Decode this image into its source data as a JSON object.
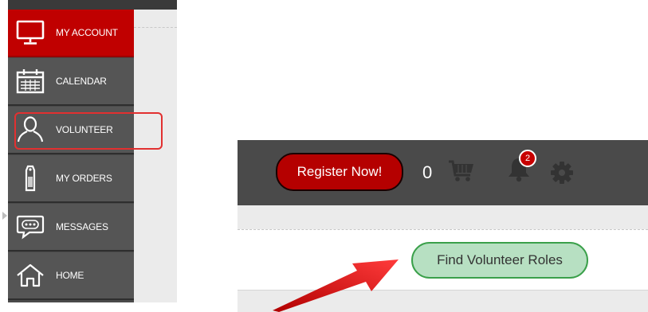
{
  "sidebar": {
    "items": [
      {
        "label": "MY ACCOUNT",
        "icon": "monitor-icon",
        "active": true
      },
      {
        "label": "CALENDAR",
        "icon": "calendar-icon",
        "active": false
      },
      {
        "label": "VOLUNTEER",
        "icon": "person-icon",
        "active": false
      },
      {
        "label": "MY ORDERS",
        "icon": "tag-icon",
        "active": false
      },
      {
        "label": "MESSAGES",
        "icon": "chat-icon",
        "active": false
      },
      {
        "label": "HOME",
        "icon": "home-icon",
        "active": false
      }
    ]
  },
  "header": {
    "register_label": "Register Now!",
    "cart_count": "0",
    "notification_count": "2"
  },
  "content": {
    "find_roles_label": "Find Volunteer Roles"
  },
  "colors": {
    "sidebar_bg": "#555555",
    "active_red": "#c00000",
    "highlight_red": "#e23030",
    "find_button_green": "#b7e0c2"
  }
}
